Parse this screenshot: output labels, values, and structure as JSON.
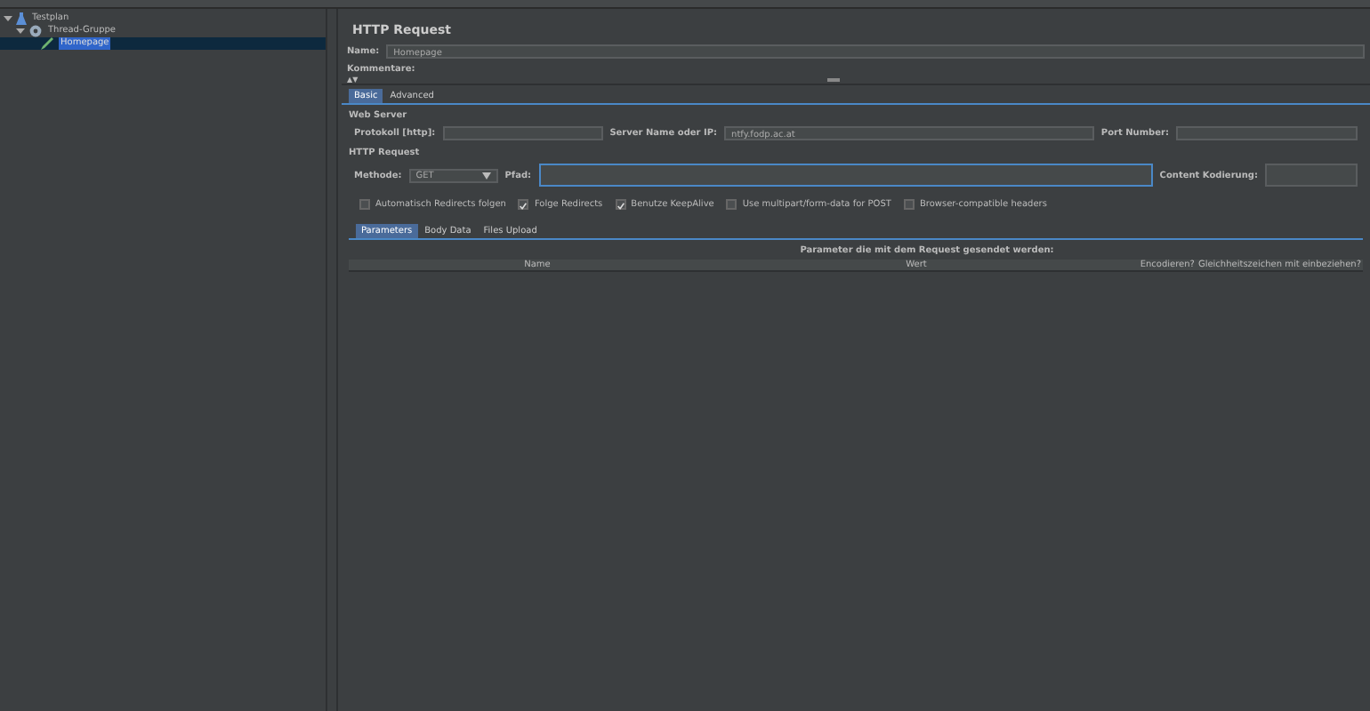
{
  "tree": [
    {
      "label": "Testplan",
      "expanded": true,
      "selected": false,
      "children": [
        {
          "label": "Thread-Gruppe",
          "expanded": true,
          "selected": false,
          "children": [
            {
              "label": "Homepage",
              "selected": true
            }
          ]
        }
      ]
    }
  ],
  "panel": {
    "title": "HTTP Request",
    "name": {
      "label": "Name:",
      "value": "Homepage"
    },
    "comments": {
      "label": "Kommentare:",
      "toggle": "▲▼"
    },
    "tabs": [
      {
        "label": "Basic",
        "selected": true
      },
      {
        "label": "Advanced",
        "selected": false
      }
    ],
    "web_server": {
      "heading": "Web Server",
      "protocol_label": "Protokoll [http]:",
      "server_label": "Server Name oder IP:",
      "server_value": "ntfy.fodp.ac.at",
      "port_label": "Port Number:"
    },
    "http_request": {
      "heading": "HTTP Request",
      "method_label": "Methode:",
      "method_value": "GET",
      "path_label": "Pfad:",
      "encoding_label": "Content Kodierung:"
    },
    "options": [
      {
        "label": "Automatisch Redirects folgen",
        "checked": false
      },
      {
        "label": "Folge Redirects",
        "checked": true
      },
      {
        "label": "Benutze KeepAlive",
        "checked": true
      },
      {
        "label": "Use multipart/form-data for POST",
        "checked": false
      },
      {
        "label": "Browser-compatible headers",
        "checked": false
      }
    ],
    "sub_tabs": [
      {
        "label": "Parameters",
        "selected": true
      },
      {
        "label": "Body Data",
        "selected": false
      },
      {
        "label": "Files Upload",
        "selected": false
      }
    ],
    "table": {
      "caption": "Parameter die mit dem Request gesendet werden:",
      "columns": [
        "Name",
        "Wert",
        "Encodieren?",
        "Gleichheitszeichen mit einbeziehen?"
      ]
    }
  }
}
